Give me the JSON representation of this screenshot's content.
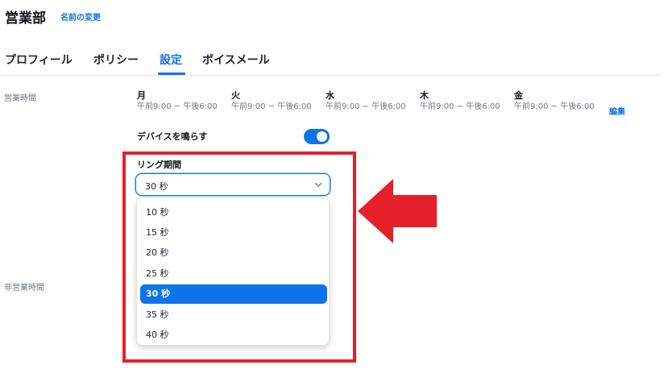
{
  "header": {
    "title": "営業部",
    "rename_link": "名前の変更"
  },
  "tabs": [
    {
      "label": "プロフィール",
      "active": false
    },
    {
      "label": "ポリシー",
      "active": false
    },
    {
      "label": "設定",
      "active": true
    },
    {
      "label": "ボイスメール",
      "active": false
    }
  ],
  "business_hours": {
    "label": "営業時間",
    "days": [
      {
        "name": "月",
        "hours": "午前9:00 ~ 午後6:00"
      },
      {
        "name": "火",
        "hours": "午前9:00 ~ 午後6:00"
      },
      {
        "name": "水",
        "hours": "午前9:00 ~ 午後6:00"
      },
      {
        "name": "木",
        "hours": "午前9:00 ~ 午後6:00"
      },
      {
        "name": "金",
        "hours": "午前9:00 ~ 午後6:00"
      }
    ],
    "edit_label": "編集",
    "ring_devices_label": "デバイスを鳴らす",
    "ring_devices_enabled": true,
    "ring_duration": {
      "label": "リング期間",
      "selected": "30 秒",
      "options": [
        "10 秒",
        "15 秒",
        "20 秒",
        "25 秒",
        "30 秒",
        "35 秒",
        "40 秒"
      ]
    }
  },
  "after_hours": {
    "label": "非営業時間"
  },
  "colors": {
    "accent": "#0e72ed",
    "highlight": "#e5202b"
  },
  "icons": {
    "dropdown_chevron": "chevron-down-icon",
    "annotation_arrow": "arrow-left-icon"
  }
}
